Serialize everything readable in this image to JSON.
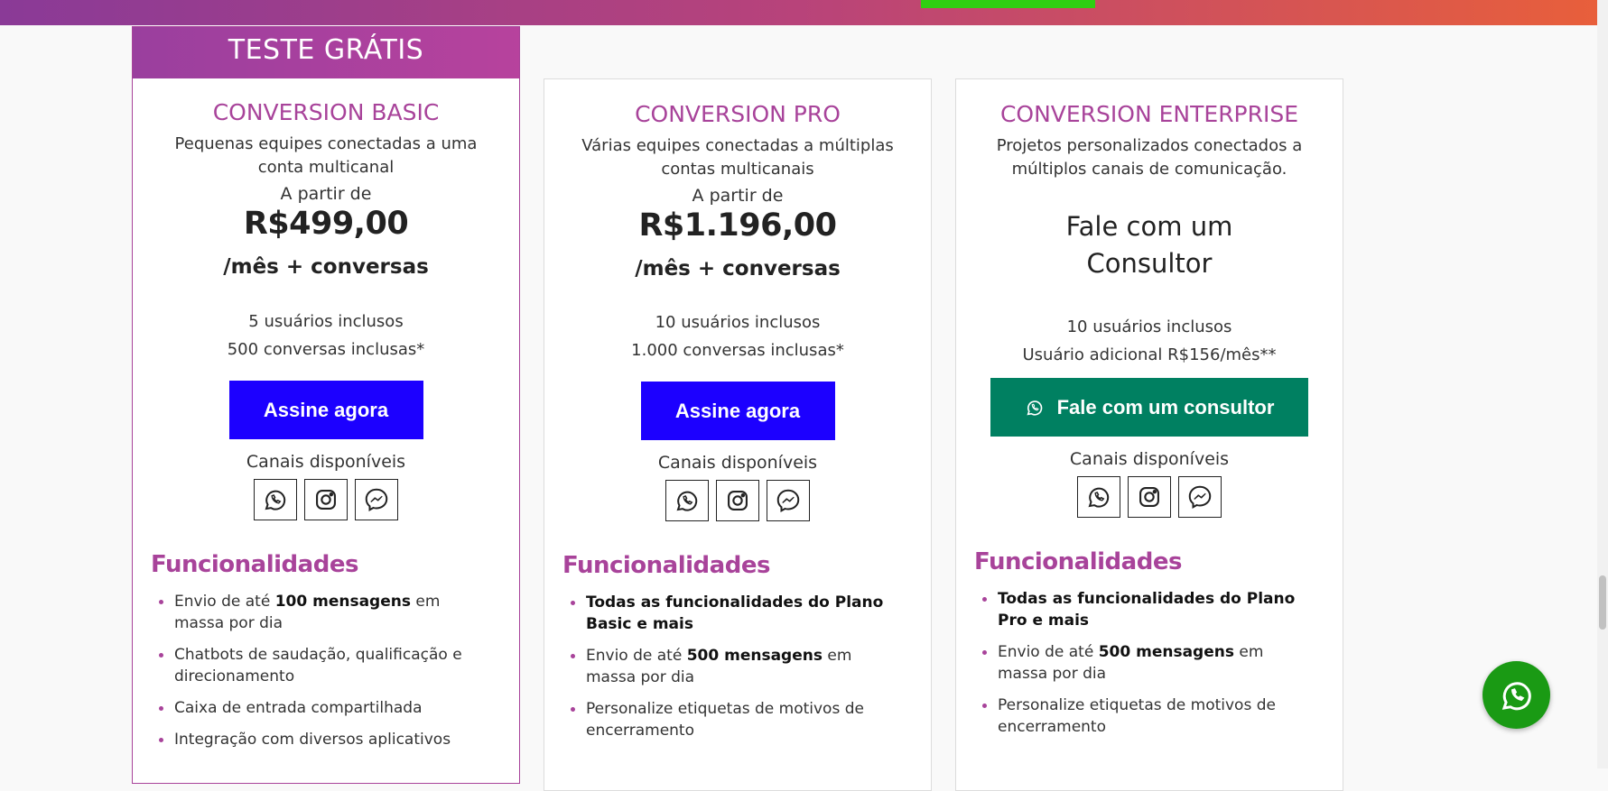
{
  "ribbon": "TESTE GRÁTIS",
  "plans": [
    {
      "name": "CONVERSION BASIC",
      "desc": "Pequenas equipes conectadas a uma conta multicanal",
      "from": "A partir de",
      "price": "R$499,00",
      "permonth": "/mês + conversas",
      "meta1": "5 usuários inclusos",
      "meta2": "500 conversas inclusas*",
      "cta": "Assine agora",
      "channels_label": "Canais disponíveis",
      "func_title": "Funcionalidades",
      "features": [
        {
          "pre": "Envio de até ",
          "bold": "100 mensagens",
          "post": " em massa por dia"
        },
        {
          "pre": "Chatbots de saudação, qualificação e direcionamento",
          "bold": "",
          "post": ""
        },
        {
          "pre": "Caixa de entrada compartilhada",
          "bold": "",
          "post": ""
        },
        {
          "pre": "Integração com diversos aplicativos",
          "bold": "",
          "post": ""
        }
      ]
    },
    {
      "name": "CONVERSION PRO",
      "desc": "Várias equipes conectadas a múltiplas contas multicanais",
      "from": "A partir de",
      "price": "R$1.196,00",
      "permonth": "/mês + conversas",
      "meta1": "10 usuários inclusos",
      "meta2": "1.000 conversas inclusas*",
      "cta": "Assine agora",
      "channels_label": "Canais disponíveis",
      "func_title": "Funcionalidades",
      "features": [
        {
          "pre": "",
          "bold": "Todas as funcionalidades do Plano Basic e mais",
          "post": ""
        },
        {
          "pre": "Envio de até ",
          "bold": "500 mensagens",
          "post": " em massa por dia"
        },
        {
          "pre": "Personalize etiquetas de motivos de encerramento",
          "bold": "",
          "post": ""
        }
      ]
    },
    {
      "name": "CONVERSION ENTERPRISE",
      "desc": "Projetos personalizados conectados a múltiplos canais de comunicação.",
      "consult": "Fale com um Consultor",
      "meta1": "10 usuários inclusos",
      "meta2": "Usuário adicional R$156/mês**",
      "cta": "Fale com um consultor",
      "channels_label": "Canais disponíveis",
      "func_title": "Funcionalidades",
      "features": [
        {
          "pre": "",
          "bold": "Todas as funcionalidades do Plano Pro e mais",
          "post": ""
        },
        {
          "pre": "Envio de até ",
          "bold": "500 mensagens",
          "post": " em massa por dia"
        },
        {
          "pre": "Personalize etiquetas de motivos de encerramento",
          "bold": "",
          "post": ""
        }
      ]
    }
  ],
  "channel_icons": [
    "whatsapp-icon",
    "instagram-icon",
    "messenger-icon"
  ],
  "colors": {
    "accent": "#a8439a",
    "cta_blue": "#1c00ff",
    "cta_teal": "#008061",
    "whatsapp_fab": "#1a9a14"
  }
}
